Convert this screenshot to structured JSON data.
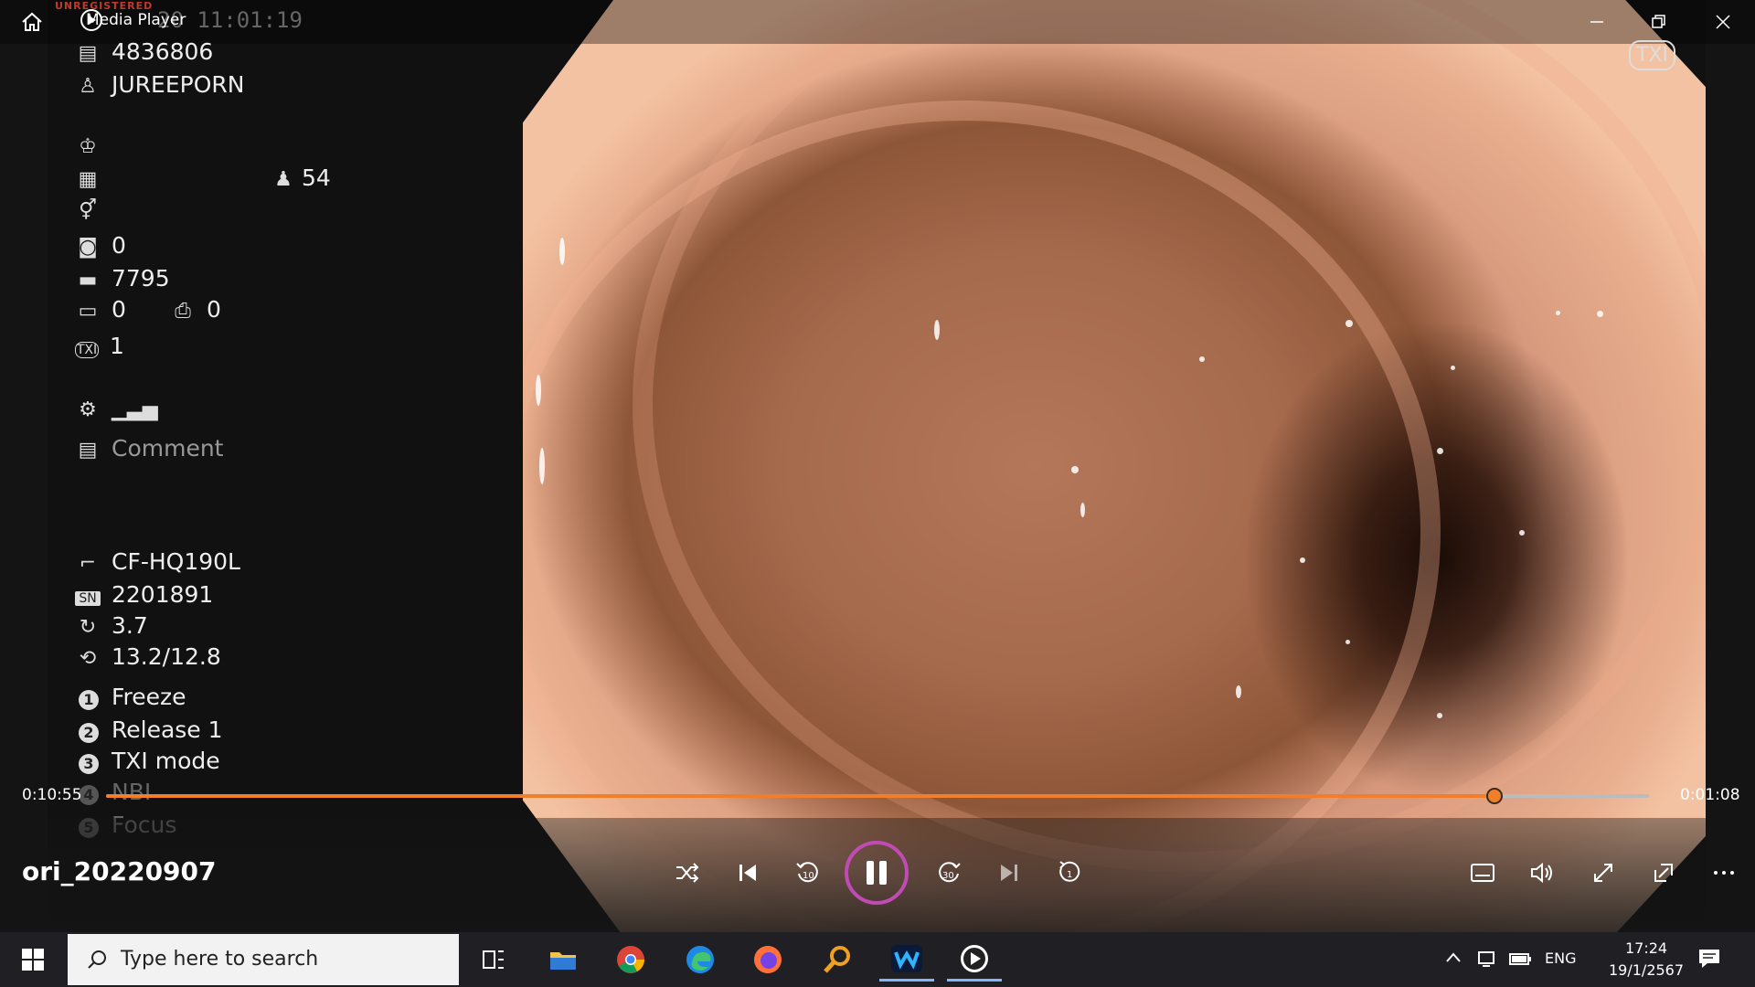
{
  "window": {
    "title": "Media Player",
    "unregistered": "UNREGISTERED",
    "timestamp_partial": "20  11:01:19"
  },
  "overlay_badge": "TXI",
  "patient_info": {
    "id": "4836806",
    "name": "JUREEPORN",
    "age": "54",
    "captures": "0",
    "counter": "7795",
    "monitor_count": "0",
    "cvp_count": "0",
    "txi_level": "1",
    "comment_placeholder": "Comment"
  },
  "scope_info": {
    "model": "CF-HQ190L",
    "serial_prefix": "SN",
    "serial": "2201891",
    "value_a": "3.7",
    "value_b": "13.2/12.8"
  },
  "button_functions": [
    {
      "num": "1",
      "label": "Freeze"
    },
    {
      "num": "2",
      "label": "Release 1"
    },
    {
      "num": "3",
      "label": "TXI mode"
    },
    {
      "num": "4",
      "label": "NBI"
    },
    {
      "num": "5",
      "label": "Focus"
    }
  ],
  "playback": {
    "current_time": "0:10:55",
    "remaining_time": "0:01:08",
    "progress": 0.9,
    "file_name": "ori_20220907"
  },
  "taskbar": {
    "search_placeholder": "Type here to search",
    "language": "ENG",
    "time": "17:24",
    "date": "19/1/2567"
  },
  "colors": {
    "accent": "#f07f2a",
    "pause_ring": "#c14bb4"
  }
}
